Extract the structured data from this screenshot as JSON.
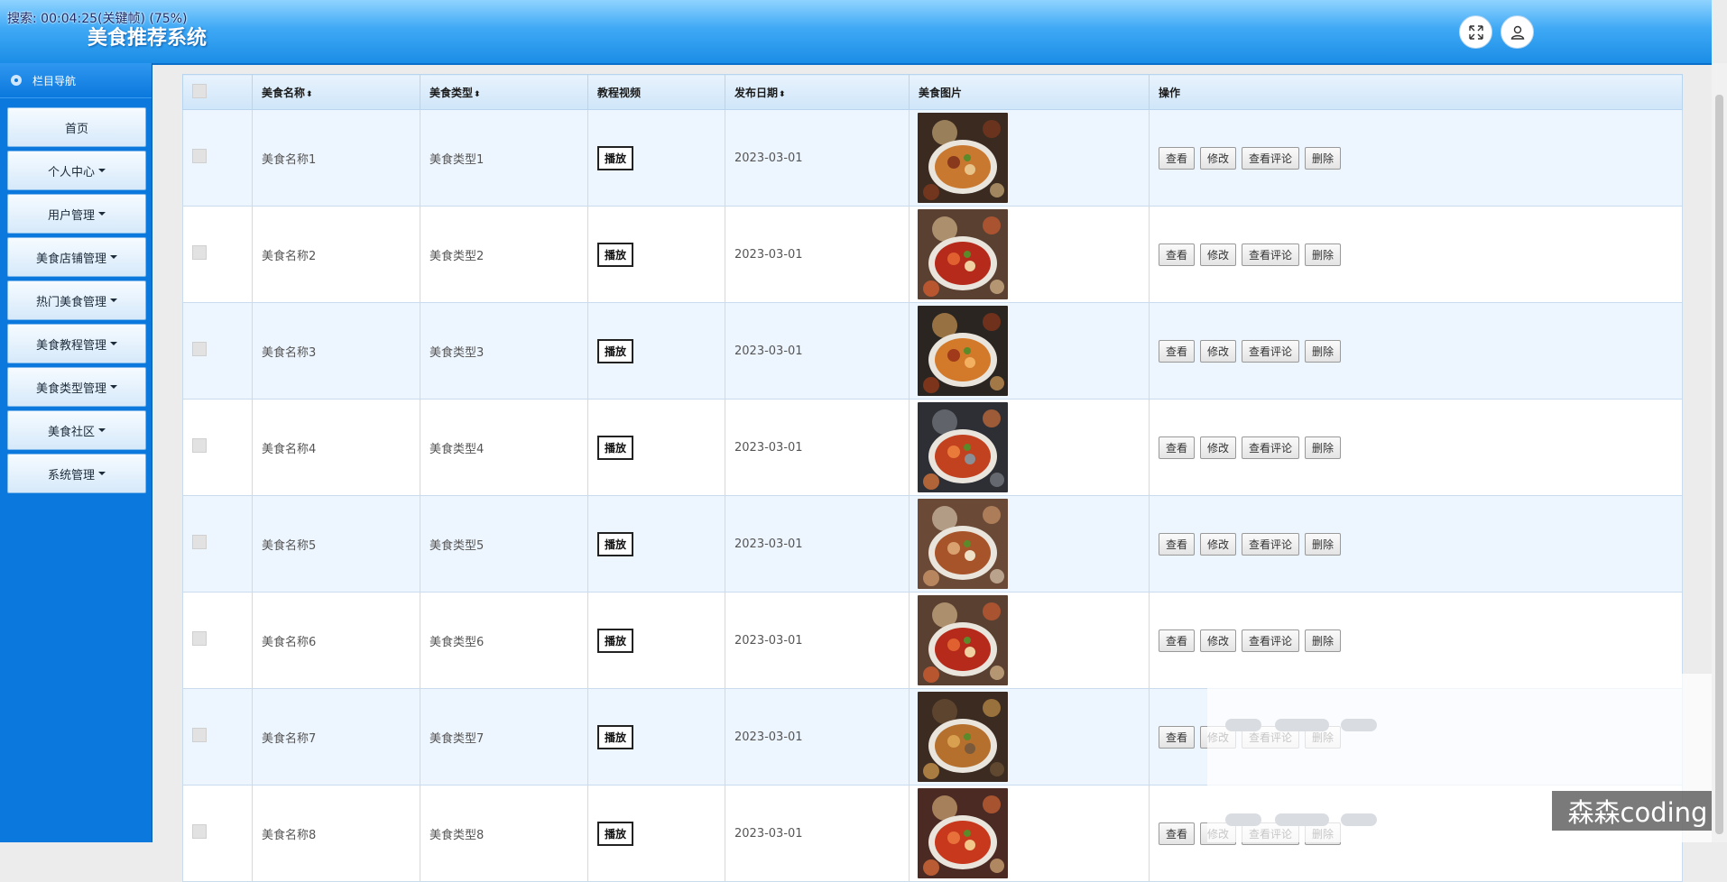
{
  "recording_status": "搜索: 00:04:25(关键帧) (75%)",
  "app_title": "美食推荐系统",
  "header_icons": {
    "fullscreen": "expand-icon",
    "user": "user-icon"
  },
  "sidebar": {
    "heading": "栏目导航",
    "items": [
      {
        "label": "首页",
        "has_caret": false
      },
      {
        "label": "个人中心",
        "has_caret": true
      },
      {
        "label": "用户管理",
        "has_caret": true
      },
      {
        "label": "美食店铺管理",
        "has_caret": true
      },
      {
        "label": "热门美食管理",
        "has_caret": true
      },
      {
        "label": "美食教程管理",
        "has_caret": true
      },
      {
        "label": "美食类型管理",
        "has_caret": true
      },
      {
        "label": "美食社区",
        "has_caret": true
      },
      {
        "label": "系统管理",
        "has_caret": true
      }
    ]
  },
  "table": {
    "columns": [
      "",
      "美食名称",
      "美食类型",
      "教程视频",
      "发布日期",
      "美食图片",
      "操作"
    ],
    "sortable": [
      false,
      true,
      true,
      false,
      true,
      false,
      false
    ],
    "play_label": "播放",
    "action_labels": [
      "查看",
      "修改",
      "查看评论",
      "删除"
    ],
    "rows": [
      {
        "name": "美食名称1",
        "type": "美食类型1",
        "date": "2023-03-01"
      },
      {
        "name": "美食名称2",
        "type": "美食类型2",
        "date": "2023-03-01"
      },
      {
        "name": "美食名称3",
        "type": "美食类型3",
        "date": "2023-03-01"
      },
      {
        "name": "美食名称4",
        "type": "美食类型4",
        "date": "2023-03-01"
      },
      {
        "name": "美食名称5",
        "type": "美食类型5",
        "date": "2023-03-01"
      },
      {
        "name": "美食名称6",
        "type": "美食类型6",
        "date": "2023-03-01"
      },
      {
        "name": "美食名称7",
        "type": "美食类型7",
        "date": "2023-03-01"
      },
      {
        "name": "美食名称8",
        "type": "美食类型8",
        "date": "2023-03-01"
      }
    ]
  },
  "watermark": "森森coding",
  "colors": {
    "sidebar": "#0b78dd",
    "header": "#1b8de6",
    "row_alt": "#edf5fe"
  }
}
